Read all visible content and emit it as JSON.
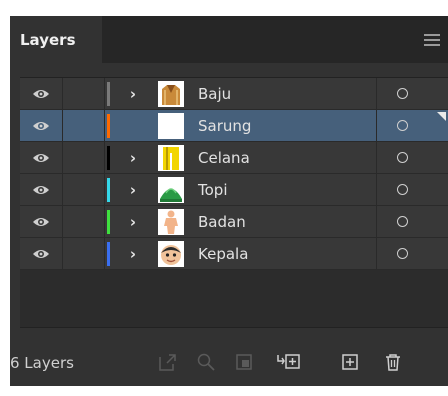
{
  "panel": {
    "tab_label": "Layers",
    "menu_icon": "hamburger-menu-icon"
  },
  "layers": [
    {
      "name": "Baju",
      "color": "#7a7a7a",
      "expandable": true,
      "selected": false,
      "thumb": "baju"
    },
    {
      "name": "Sarung",
      "color": "#ff6a00",
      "expandable": false,
      "selected": true,
      "thumb": "sarung"
    },
    {
      "name": "Celana",
      "color": "#000000",
      "expandable": true,
      "selected": false,
      "thumb": "celana"
    },
    {
      "name": "Topi",
      "color": "#35d7e9",
      "expandable": true,
      "selected": false,
      "thumb": "topi"
    },
    {
      "name": "Badan",
      "color": "#3fe03f",
      "expandable": true,
      "selected": false,
      "thumb": "badan"
    },
    {
      "name": "Kepala",
      "color": "#3a6ff0",
      "expandable": true,
      "selected": false,
      "thumb": "kepala"
    }
  ],
  "icons": {
    "eye": "eye-icon",
    "chevron": "chevron-right-icon",
    "target": "target-circle-icon"
  },
  "footer": {
    "count_label": "6 Layers",
    "buttons": [
      {
        "name": "export-button",
        "icon": "export-icon",
        "enabled": false
      },
      {
        "name": "locate-object-button",
        "icon": "search-icon",
        "enabled": false
      },
      {
        "name": "clipping-mask-button",
        "icon": "clipping-mask-icon",
        "enabled": false
      },
      {
        "name": "create-sublayer-button",
        "icon": "create-sublayer-icon",
        "enabled": true
      },
      {
        "name": "create-layer-button",
        "icon": "add-layer-icon",
        "enabled": true
      },
      {
        "name": "delete-button",
        "icon": "trash-icon",
        "enabled": true
      }
    ]
  }
}
